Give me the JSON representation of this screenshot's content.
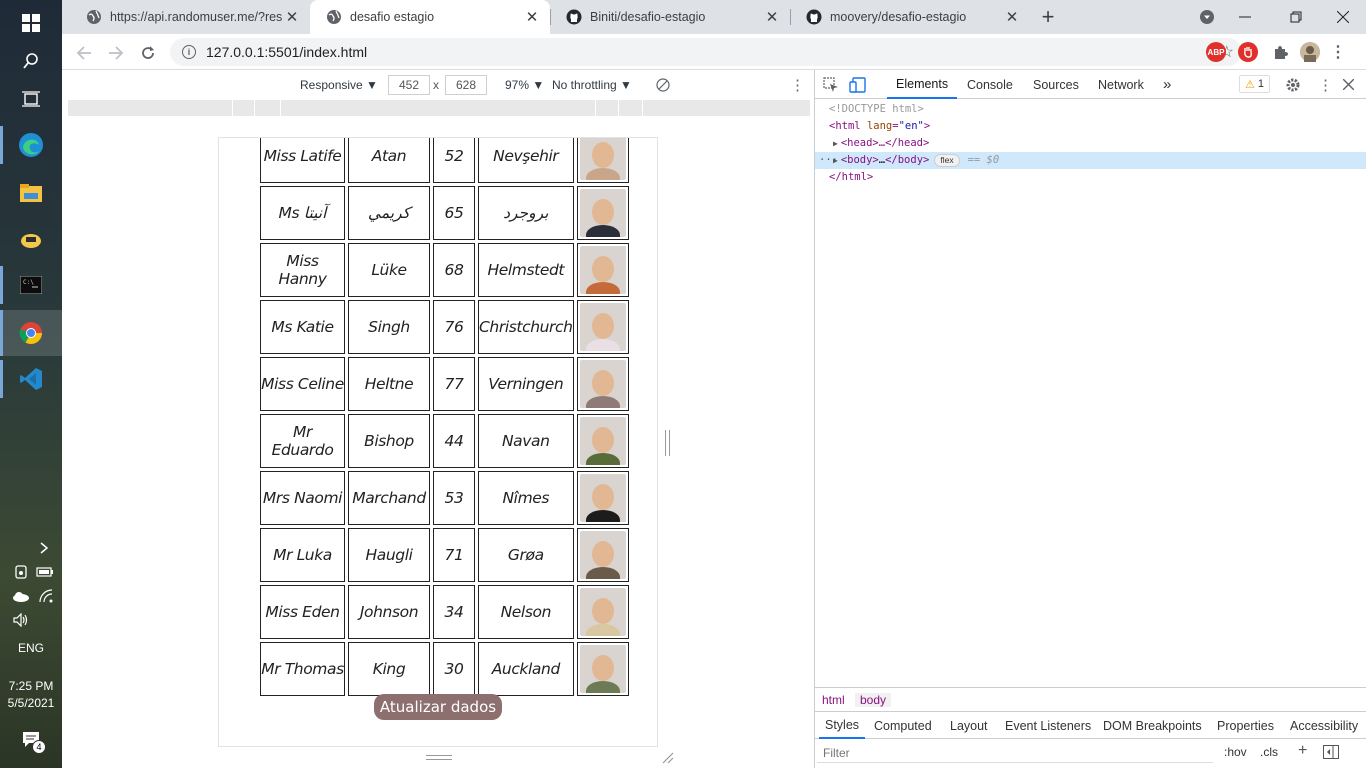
{
  "taskbar": {
    "icons": [
      "windows-start-icon",
      "search-icon",
      "task-view-icon",
      "edge-icon",
      "file-explorer-icon",
      "settings-icon",
      "terminal-icon",
      "chrome-icon",
      "vscode-icon"
    ],
    "tray": {
      "language": "ENG",
      "time": "7:25 PM",
      "date": "5/5/2021",
      "notifications_count": "4"
    }
  },
  "browser": {
    "tabs": [
      {
        "title": "https://api.randomuser.me/?resul",
        "favicon": "globe-icon"
      },
      {
        "title": "desafio estagio",
        "favicon": "globe-icon",
        "active": true
      },
      {
        "title": "Biniti/desafio-estagio",
        "favicon": "github-icon"
      },
      {
        "title": "moovery/desafio-estagio",
        "favicon": "github-icon"
      }
    ],
    "new_tab": "+",
    "url": "127.0.0.1:5501/index.html",
    "extensions": {
      "abp": "ABP"
    }
  },
  "device_toolbar": {
    "mode": "Responsive ▼",
    "width": "452",
    "height": "628",
    "times": "x",
    "zoom": "97% ▼",
    "throttling": "No throttling ▼"
  },
  "page": {
    "rows": [
      {
        "name": "Miss Latife",
        "surname": "Atan",
        "age": "52",
        "city": "Nevşehir",
        "photo_color": "#c9a68a"
      },
      {
        "name": "Ms آنيتا",
        "surname": "كريمي",
        "age": "65",
        "city": "بروجرد",
        "photo_color": "#2b2f3a"
      },
      {
        "name": "Miss Hanny",
        "surname": "Lüke",
        "age": "68",
        "city": "Helmstedt",
        "photo_color": "#c56a3a"
      },
      {
        "name": "Ms Katie",
        "surname": "Singh",
        "age": "76",
        "city": "Christchurch",
        "photo_color": "#e9dfe4"
      },
      {
        "name": "Miss Celine",
        "surname": "Heltne",
        "age": "77",
        "city": "Verningen",
        "photo_color": "#8e7a76"
      },
      {
        "name": "Mr Eduardo",
        "surname": "Bishop",
        "age": "44",
        "city": "Navan",
        "photo_color": "#5a6b3a"
      },
      {
        "name": "Mrs Naomi",
        "surname": "Marchand",
        "age": "53",
        "city": "Nîmes",
        "photo_color": "#1c1c1c"
      },
      {
        "name": "Mr Luka",
        "surname": "Haugli",
        "age": "71",
        "city": "Grøa",
        "photo_color": "#6a5a4a"
      },
      {
        "name": "Miss Eden",
        "surname": "Johnson",
        "age": "34",
        "city": "Nelson",
        "photo_color": "#d8c7a0"
      },
      {
        "name": "Mr Thomas",
        "surname": "King",
        "age": "30",
        "city": "Auckland",
        "photo_color": "#6c7a55"
      }
    ],
    "refresh_button": "Atualizar dados"
  },
  "devtools": {
    "tabs": [
      "Elements",
      "Console",
      "Sources",
      "Network"
    ],
    "more_tabs": "»",
    "warnings": "1",
    "dom": {
      "doctype": "<!DOCTYPE html>",
      "html_open_tag": "html",
      "lang_attr": "lang",
      "lang_value": "\"en\"",
      "head": "<head>…</head>",
      "body_open": "<body>",
      "body_ellipsis": "…",
      "body_close": "</body>",
      "flex_badge": "flex",
      "selected_marker": "== $0",
      "html_close": "</html>"
    },
    "breadcrumbs": [
      "html",
      "body"
    ],
    "style_tabs": [
      "Styles",
      "Computed",
      "Layout",
      "Event Listeners",
      "DOM Breakpoints",
      "Properties",
      "Accessibility"
    ],
    "filter_placeholder": "Filter",
    "hov": ":hov",
    "cls": ".cls"
  },
  "colors": {
    "accent": "#1a73e8",
    "button": "#8c6f6e",
    "selected_node": "#cfe8fc"
  }
}
